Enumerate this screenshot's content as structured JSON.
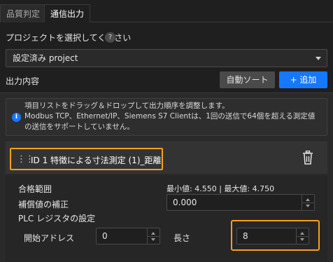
{
  "tabs": [
    {
      "label": "品質判定",
      "active": false
    },
    {
      "label": "通信出力",
      "active": true
    }
  ],
  "project": {
    "label": "プロジェクトを選択してください",
    "help_icon": "question-circle-icon",
    "selected": "設定済み project"
  },
  "output": {
    "label": "出力内容",
    "sort_button": "自動ソート",
    "add_button": "+ 追加"
  },
  "info": {
    "icon": "info-circle-icon",
    "line1": "項目リストをドラッグ＆ドロップして出力順序を調整します。",
    "line2": "Modbus TCP、Ethernet/IP、Siemens S7 Clientは、1回の送信で64個を超える測定値",
    "line3": "の送信をサポートしていません。"
  },
  "item": {
    "title": "ID 1  特徴による寸法測定 (1)_距離",
    "grip_icon": "drag-handle-icon",
    "delete_icon": "trash-icon",
    "pass_range_label": "合格範囲",
    "pass_range_value": "最小値: 4.550 | 最大値: 4.750",
    "compensation_label": "補償値の補正",
    "compensation_value": "0.000",
    "plc_label": "PLC レジスタの設定",
    "start_address_label": "開始アドレス",
    "start_address_value": "0",
    "length_label": "長さ",
    "length_value": "8"
  },
  "colors": {
    "accent": "#1677ff",
    "highlight": "#f7a01d",
    "background": "#1f1f1f"
  }
}
